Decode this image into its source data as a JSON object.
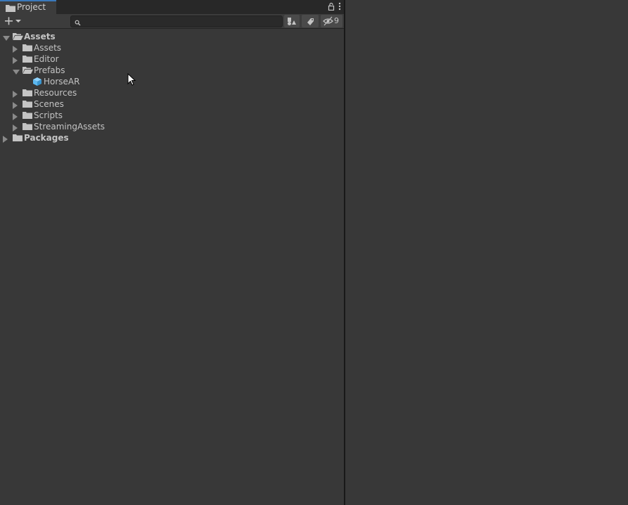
{
  "tab": {
    "title": "Project",
    "icon": "folder-icon"
  },
  "tab_tools": {
    "lock_icon": "lock-icon",
    "menu_icon": "kebab-menu-icon"
  },
  "toolbar": {
    "create_icon": "plus-icon",
    "create_dropdown_icon": "chevron-down-icon",
    "search": {
      "value": "",
      "placeholder": ""
    },
    "filter_by_type_icon": "filter-by-type-icon",
    "filter_by_label_icon": "tag-icon",
    "hidden_packages_icon": "eye-slash-icon",
    "hidden_packages_count": "9"
  },
  "tree": [
    {
      "label": "Assets",
      "depth": 0,
      "expanded": true,
      "bold": true,
      "icon": "folder-open-icon",
      "has_arrow": true
    },
    {
      "label": "Assets",
      "depth": 1,
      "expanded": false,
      "bold": false,
      "icon": "folder-icon",
      "has_arrow": true
    },
    {
      "label": "Editor",
      "depth": 1,
      "expanded": false,
      "bold": false,
      "icon": "folder-icon",
      "has_arrow": true
    },
    {
      "label": "Prefabs",
      "depth": 1,
      "expanded": true,
      "bold": false,
      "icon": "folder-open-icon",
      "has_arrow": true
    },
    {
      "label": "HorseAR",
      "depth": 2,
      "expanded": false,
      "bold": false,
      "icon": "prefab-cube-icon",
      "has_arrow": false
    },
    {
      "label": "Resources",
      "depth": 1,
      "expanded": false,
      "bold": false,
      "icon": "folder-icon",
      "has_arrow": true
    },
    {
      "label": "Scenes",
      "depth": 1,
      "expanded": false,
      "bold": false,
      "icon": "folder-icon",
      "has_arrow": true
    },
    {
      "label": "Scripts",
      "depth": 1,
      "expanded": false,
      "bold": false,
      "icon": "folder-icon",
      "has_arrow": true
    },
    {
      "label": "StreamingAssets",
      "depth": 1,
      "expanded": false,
      "bold": false,
      "icon": "folder-icon",
      "has_arrow": true
    },
    {
      "label": "Packages",
      "depth": 0,
      "expanded": false,
      "bold": true,
      "icon": "folder-icon",
      "has_arrow": true
    }
  ],
  "colors": {
    "background": "#383838",
    "tab_strip": "#282828",
    "tab_accent": "#3a79bb",
    "text": "#c4c4c4",
    "prefab_blue": "#5cb8f0"
  }
}
